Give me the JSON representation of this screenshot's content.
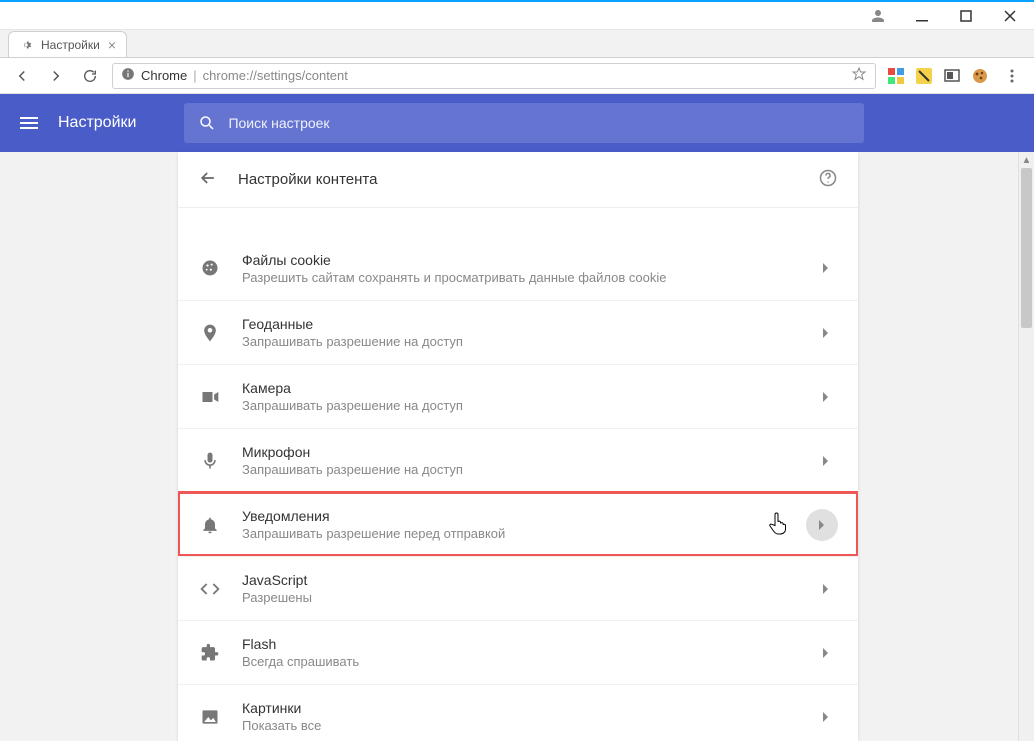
{
  "window": {
    "tab_title": "Настройки"
  },
  "address": {
    "scheme_label": "Chrome",
    "url": "chrome://settings/content"
  },
  "header": {
    "title": "Настройки",
    "search_placeholder": "Поиск настроек"
  },
  "page": {
    "title": "Настройки контента"
  },
  "rows": [
    {
      "icon": "cookie",
      "label": "Файлы cookie",
      "sub": "Разрешить сайтам сохранять и просматривать данные файлов cookie"
    },
    {
      "icon": "location",
      "label": "Геоданные",
      "sub": "Запрашивать разрешение на доступ"
    },
    {
      "icon": "camera",
      "label": "Камера",
      "sub": "Запрашивать разрешение на доступ"
    },
    {
      "icon": "mic",
      "label": "Микрофон",
      "sub": "Запрашивать разрешение на доступ"
    },
    {
      "icon": "bell",
      "label": "Уведомления",
      "sub": "Запрашивать разрешение перед отправкой",
      "highlight": true,
      "cursor": true
    },
    {
      "icon": "code",
      "label": "JavaScript",
      "sub": "Разрешены"
    },
    {
      "icon": "puzzle",
      "label": "Flash",
      "sub": "Всегда спрашивать"
    },
    {
      "icon": "image",
      "label": "Картинки",
      "sub": "Показать все"
    }
  ]
}
